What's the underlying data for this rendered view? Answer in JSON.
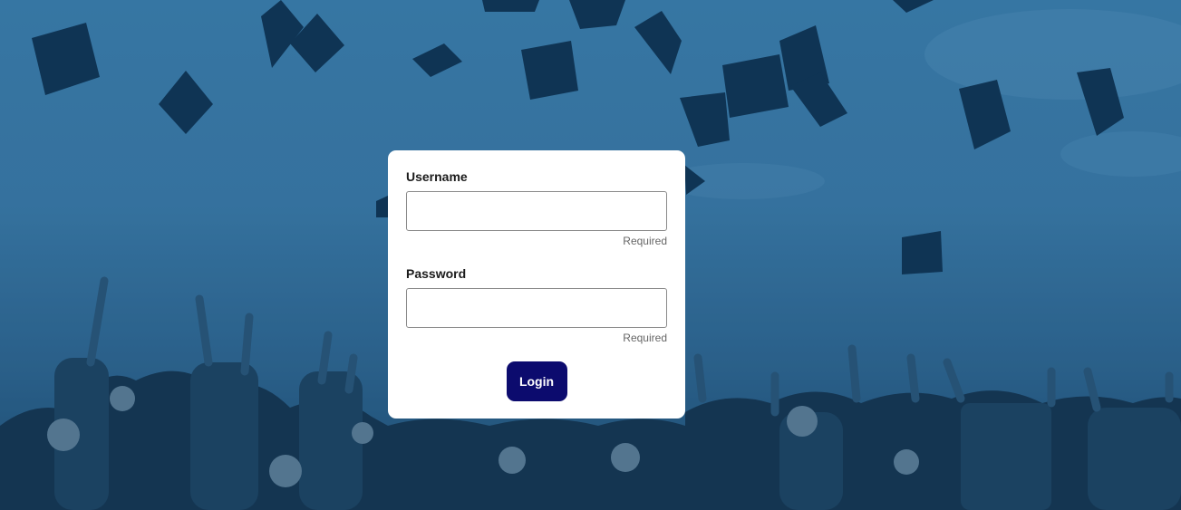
{
  "login_form": {
    "username_label": "Username",
    "username_value": "",
    "username_hint": "Required",
    "password_label": "Password",
    "password_value": "",
    "password_hint": "Required",
    "login_button_label": "Login"
  },
  "colors": {
    "sky": "#3b7aa7",
    "card_background": "#ffffff",
    "button_background": "#0c0b6e",
    "button_text": "#ffffff",
    "hint_text": "#666666"
  },
  "background": {
    "image_description_icon": "graduation-photo-icon"
  }
}
